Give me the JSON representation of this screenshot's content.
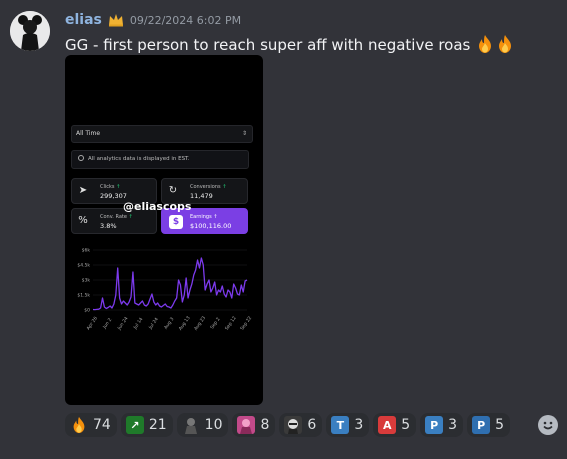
{
  "message": {
    "username": "elias",
    "timestamp": "09/22/2024 6:02 PM",
    "text": "GG - first person to reach super aff with negative roas",
    "colors": {
      "username": "#8fb4df",
      "background": "#323339"
    }
  },
  "attachment": {
    "range_select": "All Time",
    "info_text": "All analytics data is displayed in EST.",
    "stats": [
      {
        "label": "Clicks",
        "value": "299,307",
        "icon": "cursor-icon"
      },
      {
        "label": "Conversions",
        "value": "11,479",
        "icon": "refresh-icon"
      },
      {
        "label": "Conv. Rate",
        "value": "3.8%",
        "icon": "percent-icon"
      },
      {
        "label": "Earnings",
        "value": "$100,116.00",
        "icon": "dollar-icon"
      }
    ],
    "watermark": "@eliascops"
  },
  "chart_data": {
    "type": "line",
    "y_ticks": [
      "$6k",
      "$4.5k",
      "$3k",
      "$1.5k",
      "$0"
    ],
    "x_ticks": [
      "Apr 26",
      "Jun 2",
      "Jun 24",
      "Jul 14",
      "Jul 24",
      "Aug 3",
      "Aug 13",
      "Aug 23",
      "Sep 2",
      "Sep 12",
      "Sep 22"
    ],
    "ylim": [
      0,
      6000
    ],
    "values": [
      50,
      40,
      60,
      80,
      200,
      1200,
      300,
      150,
      250,
      400,
      200,
      600,
      1500,
      4200,
      1200,
      600,
      900,
      700,
      500,
      800,
      1300,
      3800,
      700,
      600,
      500,
      700,
      900,
      500,
      400,
      600,
      1100,
      1600,
      800,
      500,
      700,
      400,
      300,
      450,
      600,
      350,
      300,
      200,
      500,
      900,
      1200,
      3000,
      2500,
      800,
      1500,
      3200,
      1200,
      2000,
      2600,
      3500,
      4000,
      5000,
      4200,
      5200,
      4500,
      2000,
      2600,
      3000,
      1800,
      2200,
      2800,
      1500,
      2000,
      1800,
      2400,
      1600,
      1300,
      2000,
      1800,
      1200,
      2600,
      2200,
      1600,
      1500,
      2500,
      1800,
      2900,
      3000
    ]
  },
  "reactions": [
    {
      "icon": "fire-emoji-icon",
      "count": "74",
      "bg": "#2b2d31",
      "glyph": ""
    },
    {
      "icon": "stonks-emoji-icon",
      "count": "21",
      "bg": "#1f7a2a",
      "glyph": "↗"
    },
    {
      "icon": "character-emoji-icon",
      "count": "10",
      "bg": "#2b2d31",
      "glyph": ""
    },
    {
      "icon": "pink-character-emoji-icon",
      "count": "8",
      "bg": "#c24a8a",
      "glyph": ""
    },
    {
      "icon": "face-emoji-icon",
      "count": "6",
      "bg": "#3a3a3a",
      "glyph": ""
    },
    {
      "icon": "letter-t-emoji-icon",
      "count": "3",
      "bg": "#3a7fc1",
      "glyph": "T"
    },
    {
      "icon": "letter-a-emoji-icon",
      "count": "5",
      "bg": "#d83b3b",
      "glyph": "A"
    },
    {
      "icon": "letter-p-emoji-icon",
      "count": "3",
      "bg": "#3a7fc1",
      "glyph": "P"
    },
    {
      "icon": "letter-p-emoji-icon",
      "count": "5",
      "bg": "#2f6fb0",
      "glyph": "P"
    }
  ]
}
